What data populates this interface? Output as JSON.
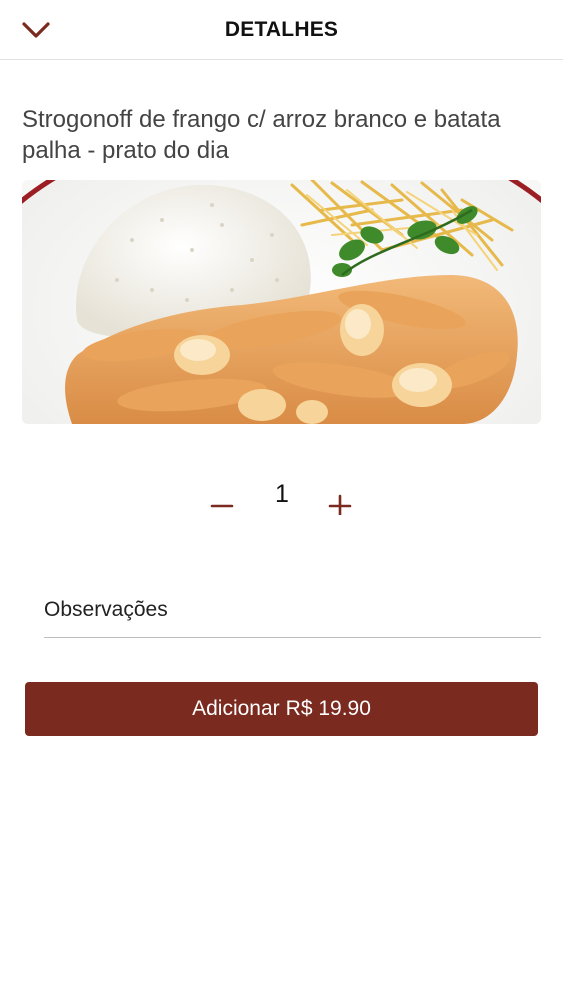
{
  "header": {
    "title": "DETALHES",
    "back_icon": "chevron-down-icon"
  },
  "product": {
    "name": "Strogonoff de frango c/ arroz branco e batata palha - prato do dia"
  },
  "quantity": {
    "value": "1",
    "minus_icon": "minus-icon",
    "plus_icon": "plus-icon"
  },
  "notes": {
    "placeholder": "Observações",
    "value": ""
  },
  "add_button": {
    "label": "Adicionar",
    "price": "R$ 19.90"
  },
  "colors": {
    "accent": "#7a2a1f",
    "divider": "#e2e2e2"
  }
}
